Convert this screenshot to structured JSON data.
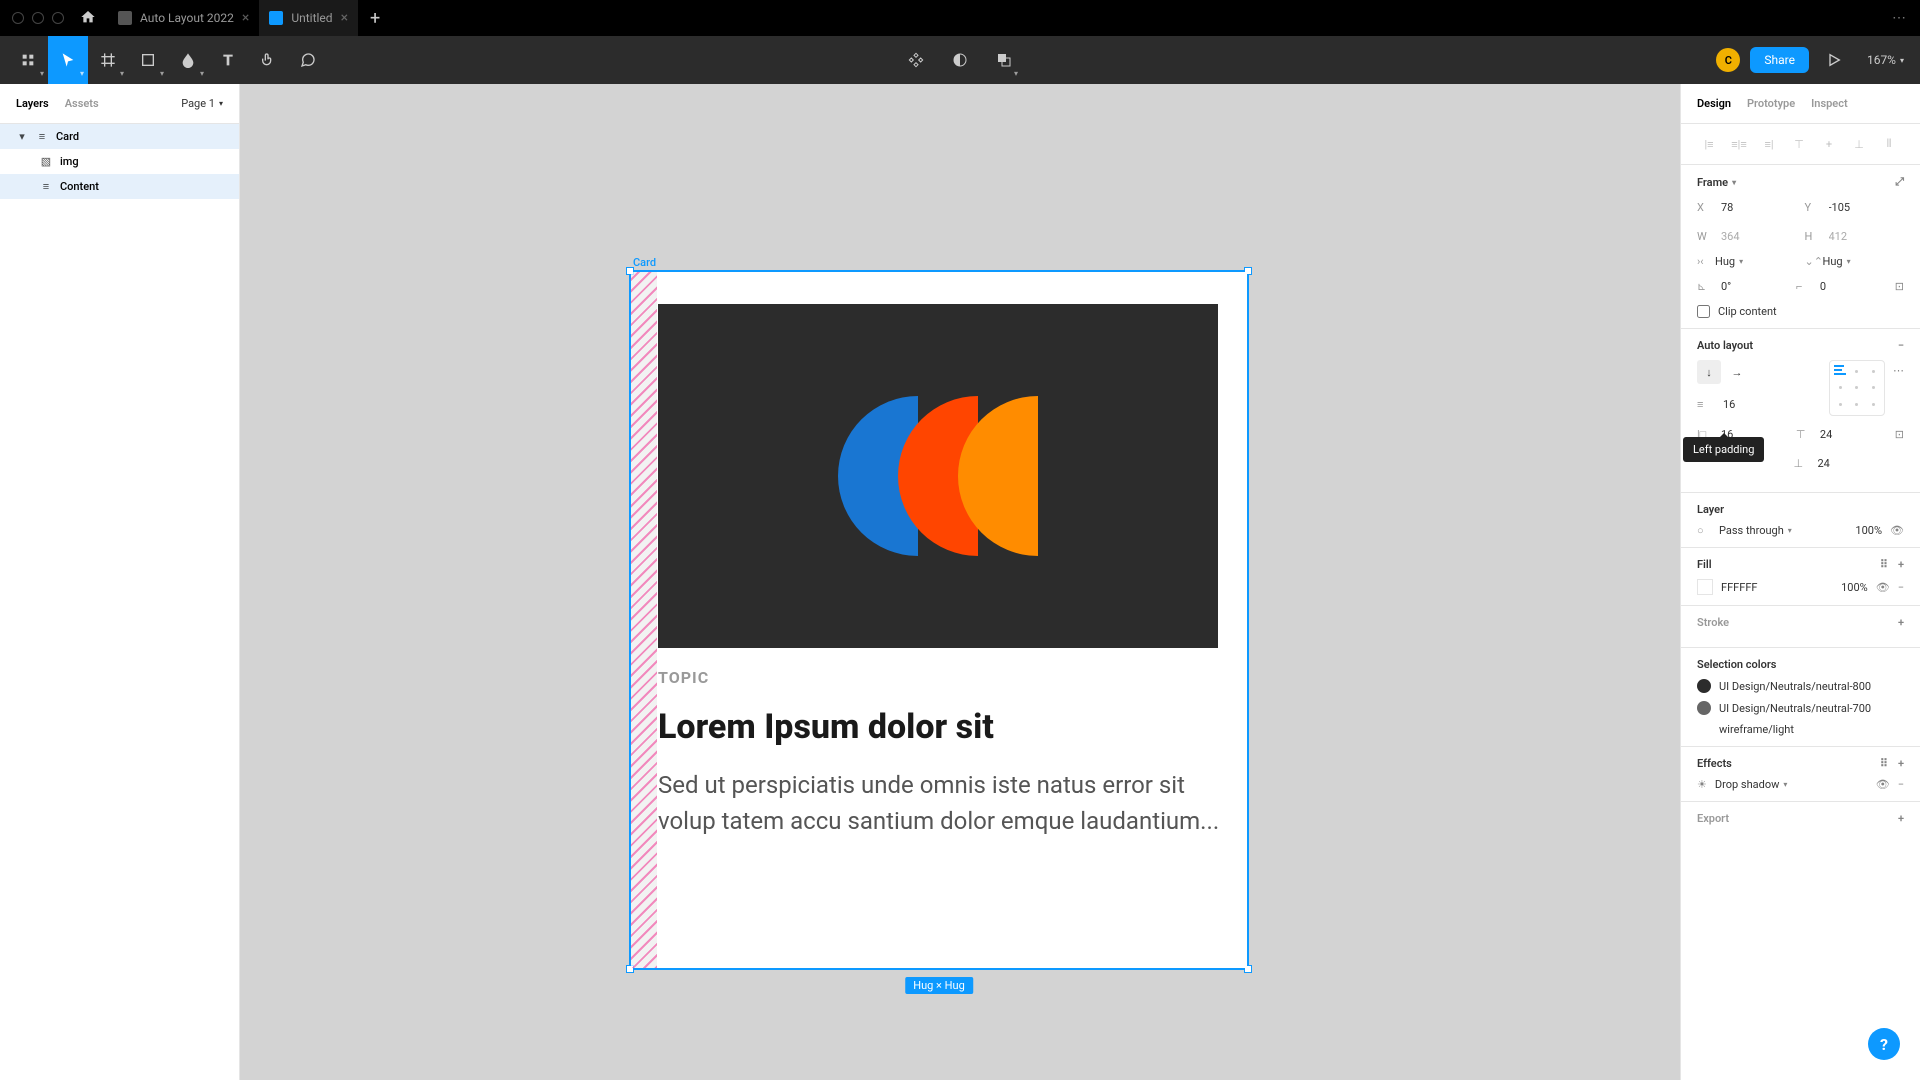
{
  "titlebar": {
    "tabs": [
      {
        "label": "Auto Layout 2022",
        "active": false
      },
      {
        "label": "Untitled",
        "active": true
      }
    ]
  },
  "toolbar": {
    "avatar_initial": "C",
    "share_label": "Share",
    "zoom": "167%"
  },
  "left_panel": {
    "tabs": {
      "layers": "Layers",
      "assets": "Assets"
    },
    "page_label": "Page 1",
    "layers": [
      {
        "name": "Card",
        "selected": true,
        "indent": 0
      },
      {
        "name": "img",
        "selected": false,
        "indent": 1
      },
      {
        "name": "Content",
        "selected": true,
        "indent": 1
      }
    ]
  },
  "card": {
    "frame_label": "Card",
    "topic": "TOPIC",
    "title": "Lorem Ipsum dolor sit",
    "body": "Sed ut perspiciatis unde omnis iste natus error sit volup tatem accu santium dolor emque laudantium...",
    "size_badge": "Hug × Hug"
  },
  "right_panel": {
    "tabs": {
      "design": "Design",
      "prototype": "Prototype",
      "inspect": "Inspect"
    },
    "frame": {
      "title": "Frame",
      "x": "78",
      "y": "-105",
      "w": "364",
      "h": "412",
      "resize_h": "Hug",
      "resize_v": "Hug",
      "rotation": "0°",
      "radius": "0",
      "clip_label": "Clip content"
    },
    "auto_layout": {
      "title": "Auto layout",
      "spacing": "16",
      "padding_left": "16",
      "padding_top": "24",
      "padding_bottom": "24",
      "tooltip": "Left padding"
    },
    "layer": {
      "title": "Layer",
      "blend": "Pass through",
      "opacity": "100%"
    },
    "fill": {
      "title": "Fill",
      "hex": "FFFFFF",
      "opacity": "100%"
    },
    "stroke": {
      "title": "Stroke"
    },
    "selection_colors": {
      "title": "Selection colors",
      "colors": [
        {
          "name": "UI Design/Neutrals/neutral-800",
          "hex": "#2c2c2c"
        },
        {
          "name": "UI Design/Neutrals/neutral-700",
          "hex": "#44403c"
        }
      ],
      "wireframe": "wireframe/light"
    },
    "effects": {
      "title": "Effects",
      "effect": "Drop shadow"
    },
    "export": {
      "title": "Export"
    }
  },
  "help": "?"
}
